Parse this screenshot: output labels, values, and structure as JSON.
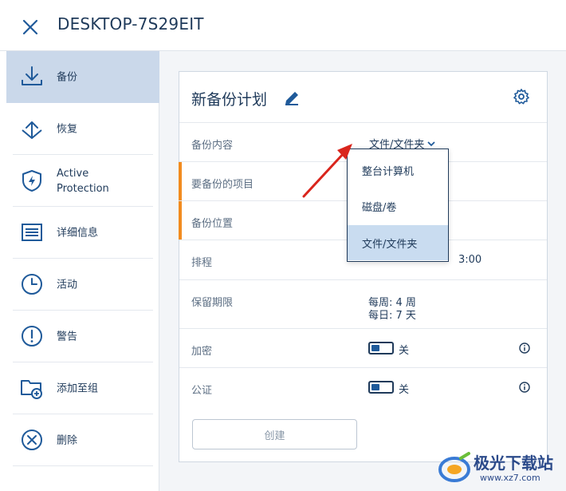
{
  "header": {
    "title": "DESKTOP-7S29EIT",
    "close_icon": "close-icon"
  },
  "sidebar": {
    "items": [
      {
        "label": "备份",
        "icon": "backup-download-icon",
        "active": true
      },
      {
        "label": "恢复",
        "icon": "recover-upload-icon"
      },
      {
        "label": "Active\nProtection",
        "icon": "shield-bolt-icon"
      },
      {
        "label": "详细信息",
        "icon": "details-list-icon"
      },
      {
        "label": "活动",
        "icon": "clock-icon"
      },
      {
        "label": "警告",
        "icon": "warning-icon"
      },
      {
        "label": "添加至组",
        "icon": "folder-add-icon"
      },
      {
        "label": "删除",
        "icon": "delete-x-icon"
      }
    ]
  },
  "panel": {
    "title": "新备份计划",
    "rows": {
      "content": {
        "label": "备份内容",
        "value": "文件/文件夹"
      },
      "items": {
        "label": "要备份的项目"
      },
      "location": {
        "label": "备份位置"
      },
      "schedule": {
        "label": "排程",
        "value_visible": "3:00"
      },
      "retention": {
        "label": "保留期限",
        "line1": "每周: 4 周",
        "line2": "每日: 7 天"
      },
      "encryption": {
        "label": "加密",
        "toggle": "关"
      },
      "notary": {
        "label": "公证",
        "toggle": "关"
      }
    },
    "create_label": "创建"
  },
  "dropdown": {
    "options": [
      "整台计算机",
      "磁盘/卷",
      "文件/文件夹"
    ],
    "selected_index": 2
  },
  "watermark": {
    "text": "极光下载站",
    "url": "www.xz7.com"
  },
  "colors": {
    "accent": "#1f3a5a",
    "active_bg": "#cad8ea",
    "marker": "#f28b1e",
    "annotation_arrow": "#d9251c"
  }
}
